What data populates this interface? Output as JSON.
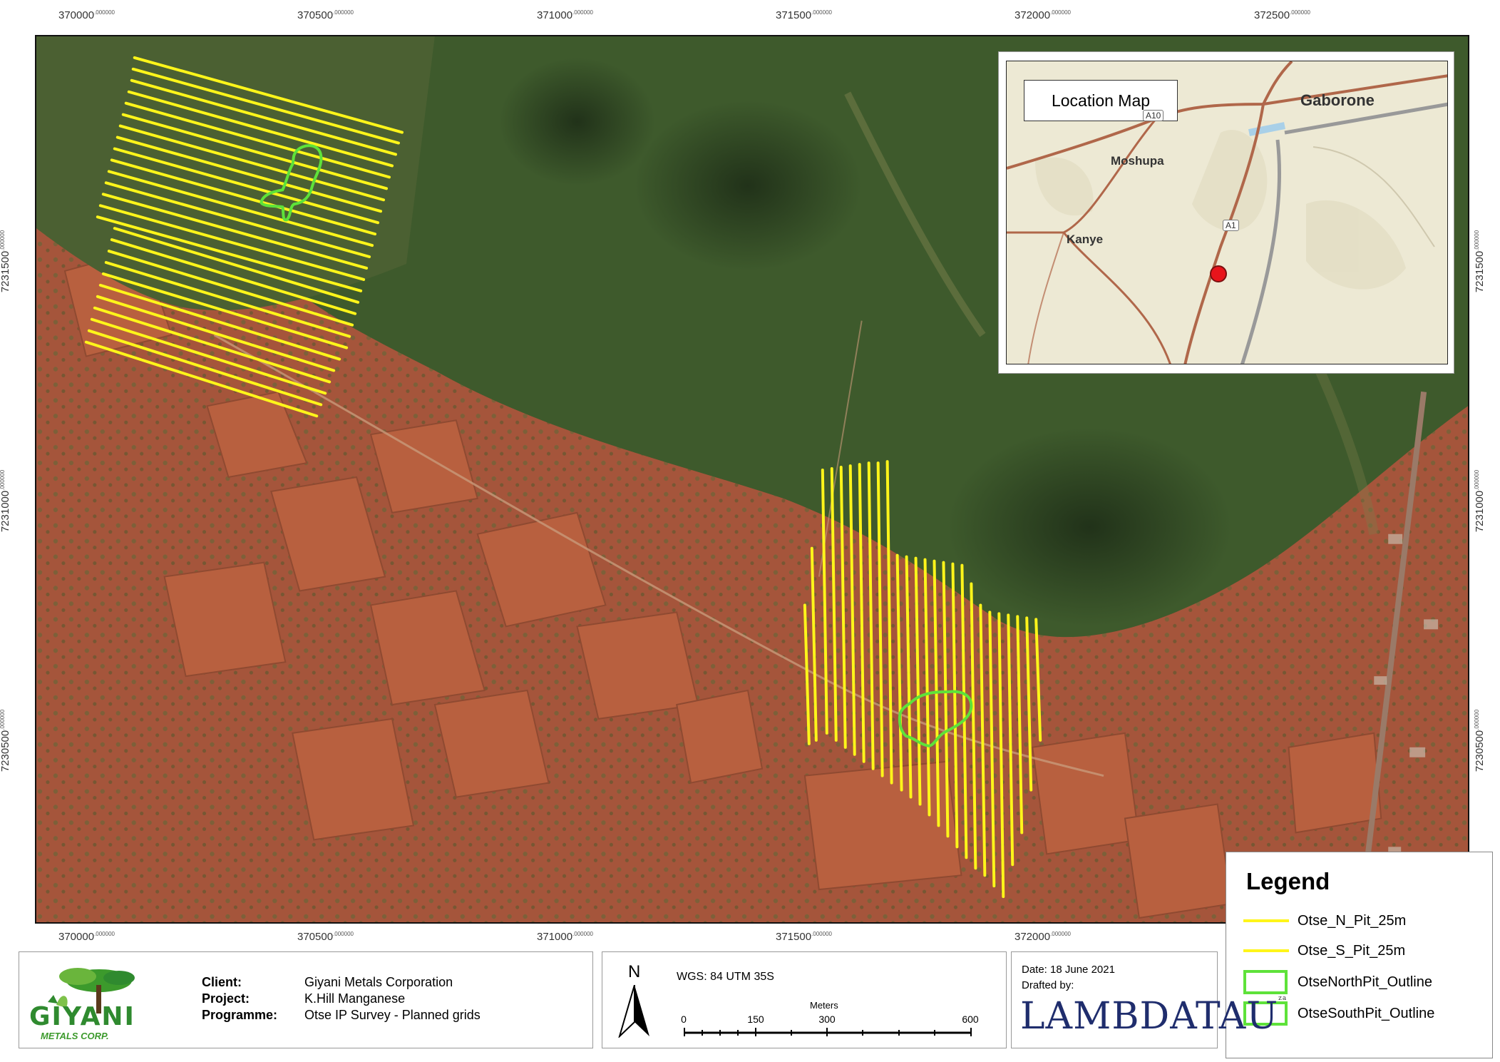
{
  "map": {
    "x_ticks": [
      {
        "main": "370000",
        "dec": ".000000"
      },
      {
        "main": "370500",
        "dec": ".000000"
      },
      {
        "main": "371000",
        "dec": ".000000"
      },
      {
        "main": "371500",
        "dec": ".000000"
      },
      {
        "main": "372000",
        "dec": ".000000"
      },
      {
        "main": "372500",
        "dec": ".000000"
      }
    ],
    "y_ticks": [
      {
        "main": "7231500",
        "dec": ".000000"
      },
      {
        "main": "7231000",
        "dec": ".000000"
      },
      {
        "main": "7230500",
        "dec": ".000000"
      }
    ],
    "colors": {
      "grid_line": "#fff51a",
      "pit_outline": "#5ee23a",
      "soil": "#b0553a",
      "vegetation": "#3d5a2a"
    }
  },
  "inset": {
    "title": "Location Map",
    "towns": {
      "gaborone": "Gaborone",
      "moshupa": "Moshupa",
      "kanye": "Kanye"
    },
    "roads": {
      "a10": "A10",
      "a1": "A1"
    },
    "marker_color": "#e8141b"
  },
  "legend": {
    "title": "Legend",
    "items": [
      {
        "label": "Otse_N_Pit_25m",
        "type": "line"
      },
      {
        "label": "Otse_S_Pit_25m",
        "type": "line"
      },
      {
        "label": "OtseNorthPit_Outline",
        "type": "polygon"
      },
      {
        "label": "OtseSouthPit_Outline",
        "type": "polygon"
      }
    ]
  },
  "info": {
    "logo_name": "GIYANI",
    "logo_sub": "METALS CORP.",
    "client_label": "Client:",
    "client_value": "Giyani Metals Corporation",
    "project_label": "Project:",
    "project_value": "K.Hill Manganese",
    "programme_label": "Programme:",
    "programme_value": "Otse IP Survey - Planned grids"
  },
  "north": {
    "letter": "N",
    "crs": "WGS: 84 UTM 35S",
    "units": "Meters",
    "scale_labels": [
      "0",
      "150",
      "300",
      "600"
    ]
  },
  "credits": {
    "date": "Date: 18 June 2021",
    "drafted": "Drafted by:",
    "company": "LAMBDATAU",
    "company_suffix": "za"
  }
}
